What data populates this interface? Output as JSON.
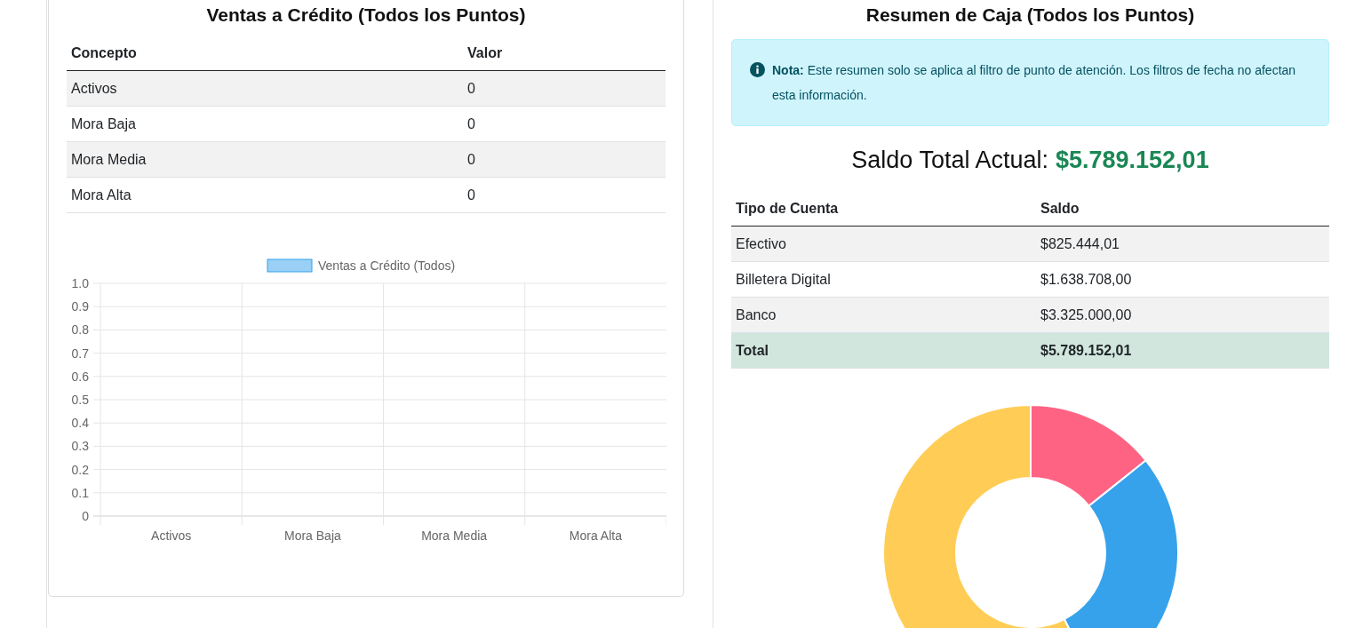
{
  "credit_sales": {
    "title": "Ventas a Crédito (Todos los Puntos)",
    "table": {
      "columns": [
        "Concepto",
        "Valor"
      ],
      "rows": [
        [
          "Activos",
          "0"
        ],
        [
          "Mora Baja",
          "0"
        ],
        [
          "Mora Media",
          "0"
        ],
        [
          "Mora Alta",
          "0"
        ]
      ]
    },
    "chart_data": {
      "type": "bar",
      "categories": [
        "Activos",
        "Mora Baja",
        "Mora Media",
        "Mora Alta"
      ],
      "series": [
        {
          "name": "Ventas a Crédito (Todos)",
          "color": "#36a2eb",
          "values": [
            0,
            0,
            0,
            0
          ]
        }
      ],
      "ylim": [
        0,
        1
      ],
      "grid": true,
      "yticks": [
        {
          "value": 0,
          "label": "0"
        },
        {
          "value": 0.1,
          "label": "0.1"
        },
        {
          "value": 0.2,
          "label": "0.2"
        },
        {
          "value": 0.3,
          "label": "0.3"
        },
        {
          "value": 0.4,
          "label": "0.4"
        },
        {
          "value": 0.5,
          "label": "0.5"
        },
        {
          "value": 0.6,
          "label": "0.6"
        },
        {
          "value": 0.7,
          "label": "0.7"
        },
        {
          "value": 0.8,
          "label": "0.8"
        },
        {
          "value": 0.9,
          "label": "0.9"
        },
        {
          "value": 1,
          "label": "1.0"
        }
      ]
    }
  },
  "cash_summary": {
    "title": "Resumen de Caja (Todos los Puntos)",
    "note": "**Nota:** Este resumen solo se aplica al filtro de punto de atención. Los filtros de fecha no afectan esta información.",
    "total_label": "Saldo Total Actual:",
    "total_value": "$5.789.152,01",
    "table": {
      "columns": [
        "Tipo de Cuenta",
        "Saldo"
      ],
      "rows": [
        {
          "kind": "normal",
          "cells": [
            "Efectivo",
            "$825.444,01"
          ]
        },
        {
          "kind": "normal",
          "cells": [
            "Billetera Digital",
            "$1.638.708,00"
          ]
        },
        {
          "kind": "normal",
          "cells": [
            "Banco",
            "$3.325.000,00"
          ]
        },
        {
          "kind": "total",
          "cells": [
            "Total",
            "$5.789.152,01"
          ]
        }
      ]
    }
  }
}
